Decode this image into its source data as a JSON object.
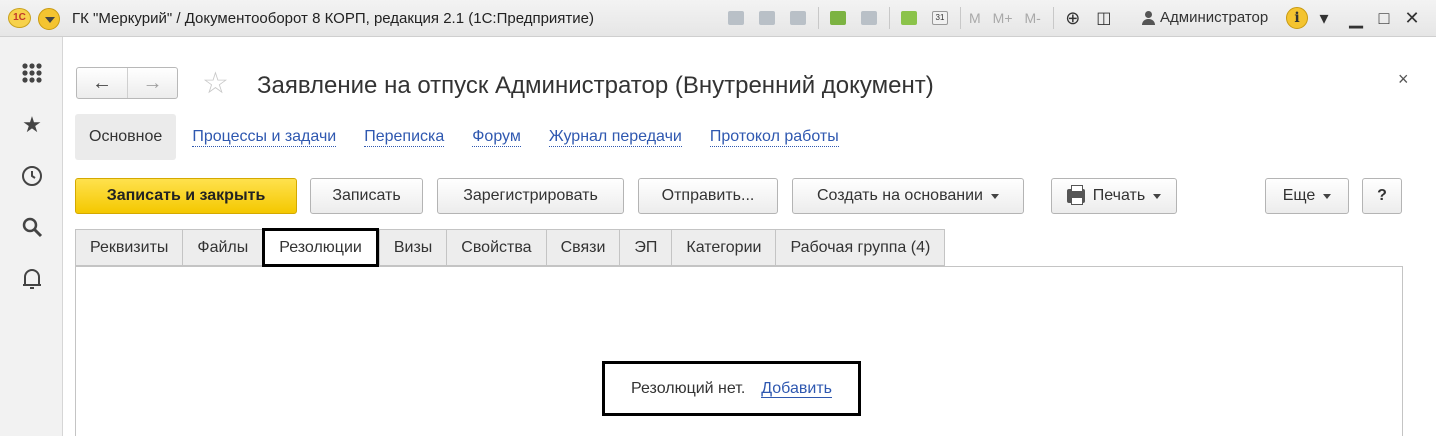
{
  "titlebar": {
    "logo_text": "1С",
    "window_title": "ГК \"Меркурий\" / Документооборот 8 КОРП, редакция 2.1  (1С:Предприятие)",
    "memory_buttons": [
      "M",
      "M+",
      "M-"
    ],
    "user_name": "Администратор",
    "info_symbol": "i",
    "icons": [
      "save-icon",
      "print-icon",
      "preview-icon",
      "download-icon",
      "scanner-icon",
      "calculator-icon",
      "calendar-icon",
      "zoom-icon",
      "panels-icon",
      "user-icon",
      "info-icon"
    ]
  },
  "left_panel": {
    "icons": [
      "apps-grid-icon",
      "favorites-star-icon",
      "history-icon",
      "search-icon",
      "notifications-bell-icon"
    ]
  },
  "form": {
    "title": "Заявление на отпуск Администратор (Внутренний документ)",
    "close_symbol": "×",
    "nav_back": "←",
    "nav_forward": "→",
    "star_symbol": "☆",
    "sections": {
      "main": "Основное",
      "links": [
        "Процессы и задачи",
        "Переписка",
        "Форум",
        "Журнал передачи",
        "Протокол работы"
      ]
    },
    "commands": {
      "save_close": "Записать и закрыть",
      "save": "Записать",
      "register": "Зарегистрировать",
      "send": "Отправить...",
      "create_based": "Создать на основании",
      "print": "Печать",
      "more": "Еще",
      "help": "?"
    },
    "tabs": [
      "Реквизиты",
      "Файлы",
      "Резолюции",
      "Визы",
      "Свойства",
      "Связи",
      "ЭП",
      "Категории",
      "Рабочая группа (4)"
    ],
    "active_tab": "Резолюции",
    "empty_state": {
      "text": "Резолюций нет.",
      "add_link": "Добавить"
    }
  }
}
